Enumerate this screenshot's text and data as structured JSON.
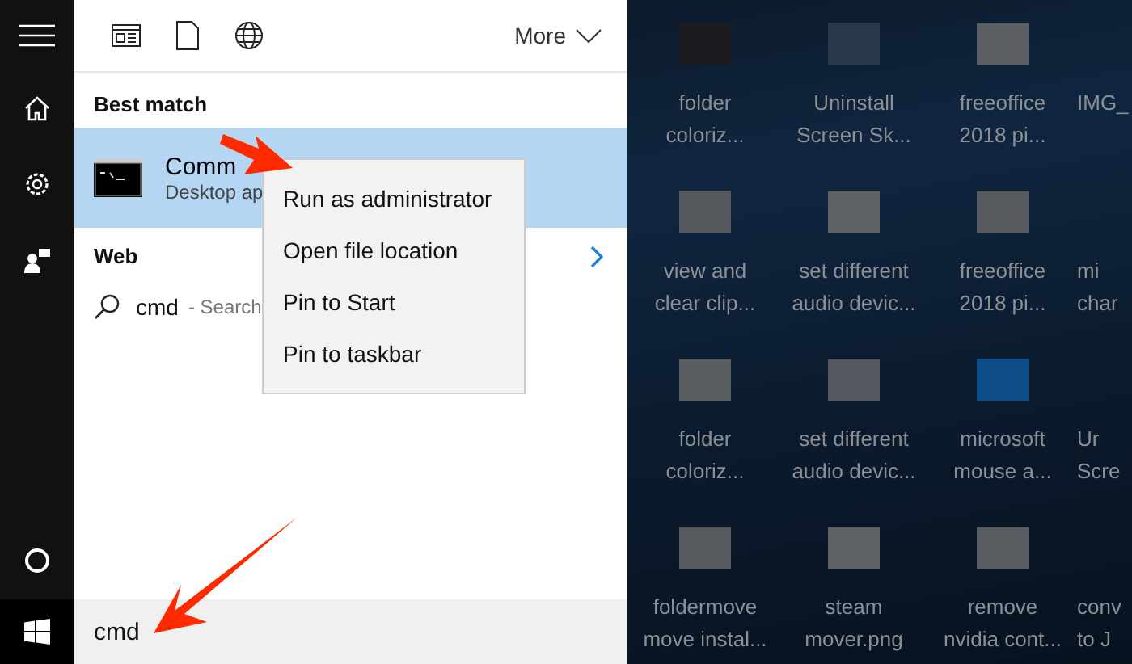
{
  "toolbar": {
    "more_label": "More"
  },
  "best_match": {
    "heading": "Best match",
    "result": {
      "title": "Comm",
      "subtitle": "Desktop ap",
      "selected": true
    }
  },
  "web": {
    "heading": "Web",
    "result": {
      "query": "cmd",
      "hint": "- Search"
    }
  },
  "context_menu": {
    "items": [
      "Run as administrator",
      "Open file location",
      "Pin to Start",
      "Pin to taskbar"
    ]
  },
  "search_box": {
    "value": "cmd"
  },
  "desktop": {
    "items": [
      {
        "lines": [
          "folder",
          "coloriz..."
        ],
        "color": "#1a1c20"
      },
      {
        "lines": [
          "Uninstall",
          "Screen Sk..."
        ],
        "color": "#2a3a4e"
      },
      {
        "lines": [
          "freeoffice",
          "2018 pi..."
        ],
        "color": "#5c5f63"
      },
      {
        "lines": [
          "IMG_"
        ]
      },
      {
        "lines": [
          "view and",
          "clear clip..."
        ],
        "color": "#55585c"
      },
      {
        "lines": [
          "set different",
          "audio devic..."
        ],
        "color": "#5e6165"
      },
      {
        "lines": [
          "freeoffice",
          "2018 pi..."
        ],
        "color": "#56595d"
      },
      {
        "lines": [
          "mi",
          "char"
        ]
      },
      {
        "lines": [
          "folder",
          "coloriz..."
        ],
        "color": "#5a5d61"
      },
      {
        "lines": [
          "set different",
          "audio devic..."
        ],
        "color": "#54575d"
      },
      {
        "lines": [
          "microsoft",
          "mouse a..."
        ],
        "color": "#0f4d8a"
      },
      {
        "lines": [
          "Ur",
          "Scre"
        ]
      },
      {
        "lines": [
          "foldermove",
          "move instal..."
        ],
        "color": "#56595d"
      },
      {
        "lines": [
          "steam",
          "mover.png"
        ],
        "color": "#5e6165"
      },
      {
        "lines": [
          "remove",
          "nvidia cont..."
        ],
        "color": "#595c60"
      },
      {
        "lines": [
          "conv",
          "to J"
        ]
      }
    ]
  }
}
